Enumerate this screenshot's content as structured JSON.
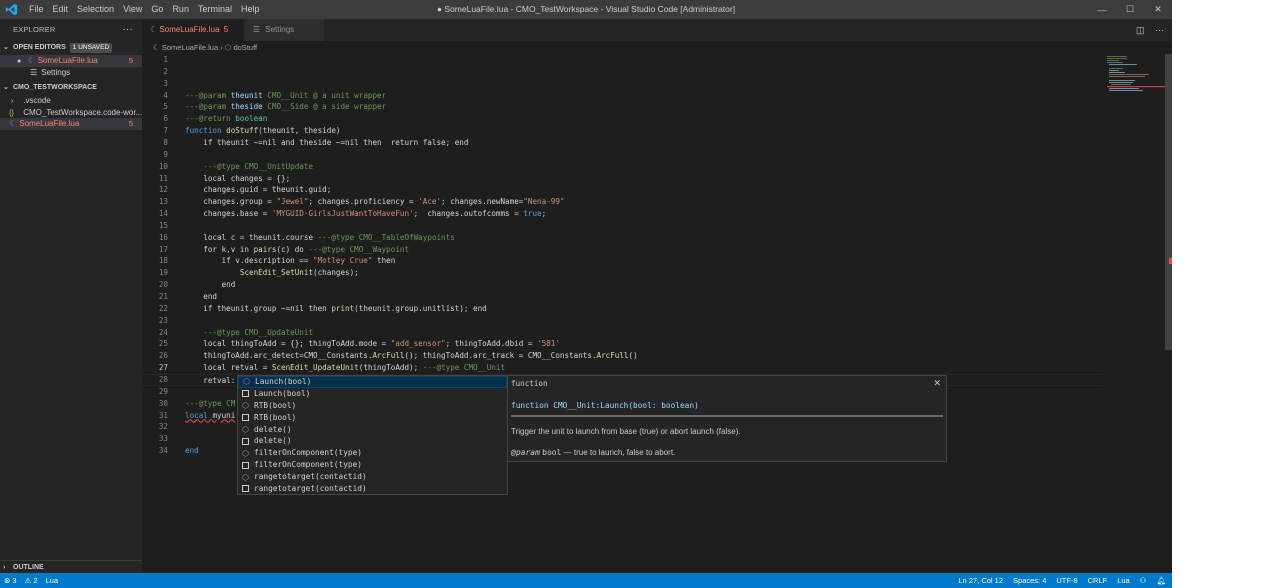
{
  "titlebar": {
    "title": "● SomeLuaFile.lua - CMO_TestWorkspace - Visual Studio Code [Administrator]",
    "menu": [
      "File",
      "Edit",
      "Selection",
      "View",
      "Go",
      "Run",
      "Terminal",
      "Help"
    ],
    "minimize_glyph": "—",
    "maximize_glyph": "☐",
    "close_glyph": "✕"
  },
  "sidebar": {
    "header": "EXPLORER",
    "more_glyph": "···",
    "open_editors": {
      "title": "OPEN EDITORS",
      "badge": "1 UNSAVED",
      "items": [
        {
          "label": "SomeLuaFile.lua",
          "count": "5",
          "dirty": "●"
        },
        {
          "label": "Settings",
          "count": ""
        }
      ]
    },
    "workspace": {
      "title": "CMO_TESTWORKSPACE",
      "items": [
        {
          "label": ".vscode",
          "count": ""
        },
        {
          "label": "CMO_TestWorkspace.code-wor...",
          "count": ""
        },
        {
          "label": "SomeLuaFile.lua",
          "count": "5"
        }
      ]
    },
    "outline": "OUTLINE"
  },
  "tabs": [
    {
      "label": "SomeLuaFile.lua",
      "count": "5"
    },
    {
      "label": "Settings"
    }
  ],
  "breadcrumb": {
    "file": "SomeLuaFile.lua",
    "sep": "›",
    "symbol": "doStuff"
  },
  "editor": {
    "cursor_line": 27,
    "lines": [
      {
        "n": "1"
      },
      {
        "n": "2"
      },
      {
        "n": "3"
      },
      {
        "n": "4"
      },
      {
        "n": "5"
      },
      {
        "n": "6"
      },
      {
        "n": "7"
      },
      {
        "n": "8"
      },
      {
        "n": "9"
      },
      {
        "n": "10"
      },
      {
        "n": "11"
      },
      {
        "n": "12"
      },
      {
        "n": "13"
      },
      {
        "n": "14"
      },
      {
        "n": "15"
      },
      {
        "n": "16"
      },
      {
        "n": "17"
      },
      {
        "n": "18"
      },
      {
        "n": "19"
      },
      {
        "n": "20"
      },
      {
        "n": "21"
      },
      {
        "n": "22"
      },
      {
        "n": "23"
      },
      {
        "n": "24"
      },
      {
        "n": "25"
      },
      {
        "n": "26"
      },
      {
        "n": "27"
      },
      {
        "n": "28"
      },
      {
        "n": "29"
      },
      {
        "n": "30"
      },
      {
        "n": "31"
      },
      {
        "n": "32"
      },
      {
        "n": "33"
      },
      {
        "n": "34"
      }
    ],
    "code": {
      "l3_a": "---@param ",
      "l3_b": "theunit",
      "l3_c": " CMO__Unit @ a unit wrapper",
      "l4_a": "---@param ",
      "l4_b": "theside",
      "l4_c": " CMO__Side @ a side wrapper",
      "l5_a": "---@return ",
      "l5_b": "boolean",
      "l6_a": "function ",
      "l6_b": "doStuff",
      "l6_c": "(theunit, theside)",
      "l7": "    if theunit ~=nil and theside ~=nil then  return false; end",
      "l9": "    ---@type CMO__UnitUpdate",
      "l10": "    local changes = {};",
      "l11": "    changes.guid = theunit.guid;",
      "l12_a": "    changes.group = ",
      "l12_b": "\"Jewel\"",
      "l12_c": "; changes.proficiency = ",
      "l12_d": "'Ace'",
      "l12_e": "; changes.newName=",
      "l12_f": "\"Nena-99\"",
      "l13_a": "    changes.base = ",
      "l13_b": "'MYGUID-GirlsJustWantToHaveFun'",
      "l13_c": ";  changes.outofcomms = ",
      "l13_d": "true",
      "l13_e": ";",
      "l15_a": "    local c = theunit.course ",
      "l15_b": "---@type CMO__TableOfWaypoints",
      "l16_a": "    for k,v in ",
      "l16_b": "pairs",
      "l16_c": "(c) do ",
      "l16_d": "---@type CMO__Waypoint",
      "l17_a": "        if v.description == ",
      "l17_b": "\"Motley Crue\"",
      "l17_c": " then",
      "l18_a": "            ",
      "l18_b": "ScenEdit_SetUnit",
      "l18_c": "(changes);",
      "l19": "        end",
      "l20": "    end",
      "l21_a": "    if theunit.group ~=nil then ",
      "l21_b": "print",
      "l21_c": "(theunit.group.unitlist); end",
      "l23": "    ---@type CMO__UpdateUnit",
      "l24_a": "    local thingToAdd = {}; thingToAdd.mode = ",
      "l24_b": "\"add_sensor\"",
      "l24_c": "; thingToAdd.dbid = ",
      "l24_d": "'581'",
      "l25_a": "    thingToAdd.arc_detect=CMO__Constants.",
      "l25_b": "ArcFull",
      "l25_c": "(); thingToAdd.arc_track = CMO__Constants.",
      "l25_d": "ArcFull",
      "l25_e": "()",
      "l26_a": "    local retval = ",
      "l26_b": "ScenEdit_UpdateUnit",
      "l26_c": "(thingToAdd); ",
      "l26_d": "---@type CMO__Unit",
      "l27": "    retval:",
      "l30": "---@type CM",
      "l31_a": "local ",
      "l31_b": "myuni",
      "l34": "end"
    }
  },
  "suggest": {
    "items": [
      {
        "label": "Launch(bool)",
        "kind": "method"
      },
      {
        "label": "Launch(bool)",
        "kind": "text"
      },
      {
        "label": "RTB(bool)",
        "kind": "method"
      },
      {
        "label": "RTB(bool)",
        "kind": "text"
      },
      {
        "label": "delete()",
        "kind": "method"
      },
      {
        "label": "delete()",
        "kind": "text"
      },
      {
        "label": "filterOnComponent(type)",
        "kind": "method"
      },
      {
        "label": "filterOnComponent(type)",
        "kind": "text"
      },
      {
        "label": "rangetotarget(contactid)",
        "kind": "method"
      },
      {
        "label": "rangetotarget(contactid)",
        "kind": "text"
      }
    ],
    "method_glyph": "⬡",
    "details": {
      "type": "function",
      "close": "✕",
      "signature": "function CMO__Unit:Launch(bool: boolean)",
      "doc": "Trigger the unit to launch from base (true) or abort launch (false).",
      "param_tag": "@param",
      "param_name": "bool",
      "param_desc": "— true to launch, false to abort."
    }
  },
  "statusbar": {
    "errors": "⊗ 3",
    "warnings": "⚠ 2",
    "lang_server": "Lua",
    "position": "Ln 27, Col 12",
    "spaces": "Spaces: 4",
    "encoding": "UTF-8",
    "eol": "CRLF",
    "language": "Lua"
  },
  "colors": {
    "accent": "#007acc",
    "error": "#f48771",
    "comment": "#6a9955",
    "keyword": "#569cd6",
    "string": "#ce9178",
    "function": "#dcdcaa"
  }
}
